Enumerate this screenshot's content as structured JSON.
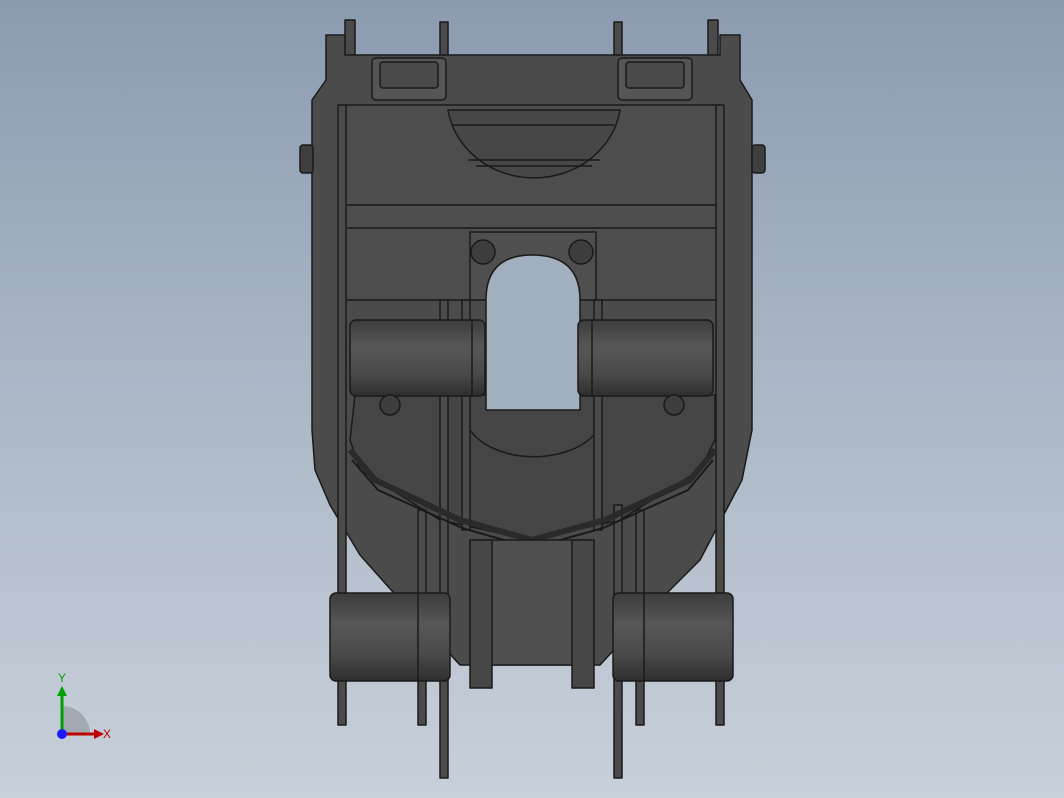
{
  "viewport": {
    "background_top": "#8b9bb0",
    "background_bottom": "#c8d0da"
  },
  "model": {
    "body_color": "#4b4b4b",
    "edge_color": "#1a1a1a",
    "shade_color": "#3f3f3f",
    "light_color": "#5a5a5a"
  },
  "triad": {
    "x_label": "X",
    "y_label": "Y",
    "x_color": "#c00000",
    "y_color": "#00a000",
    "z_color": "#1a1aff"
  }
}
